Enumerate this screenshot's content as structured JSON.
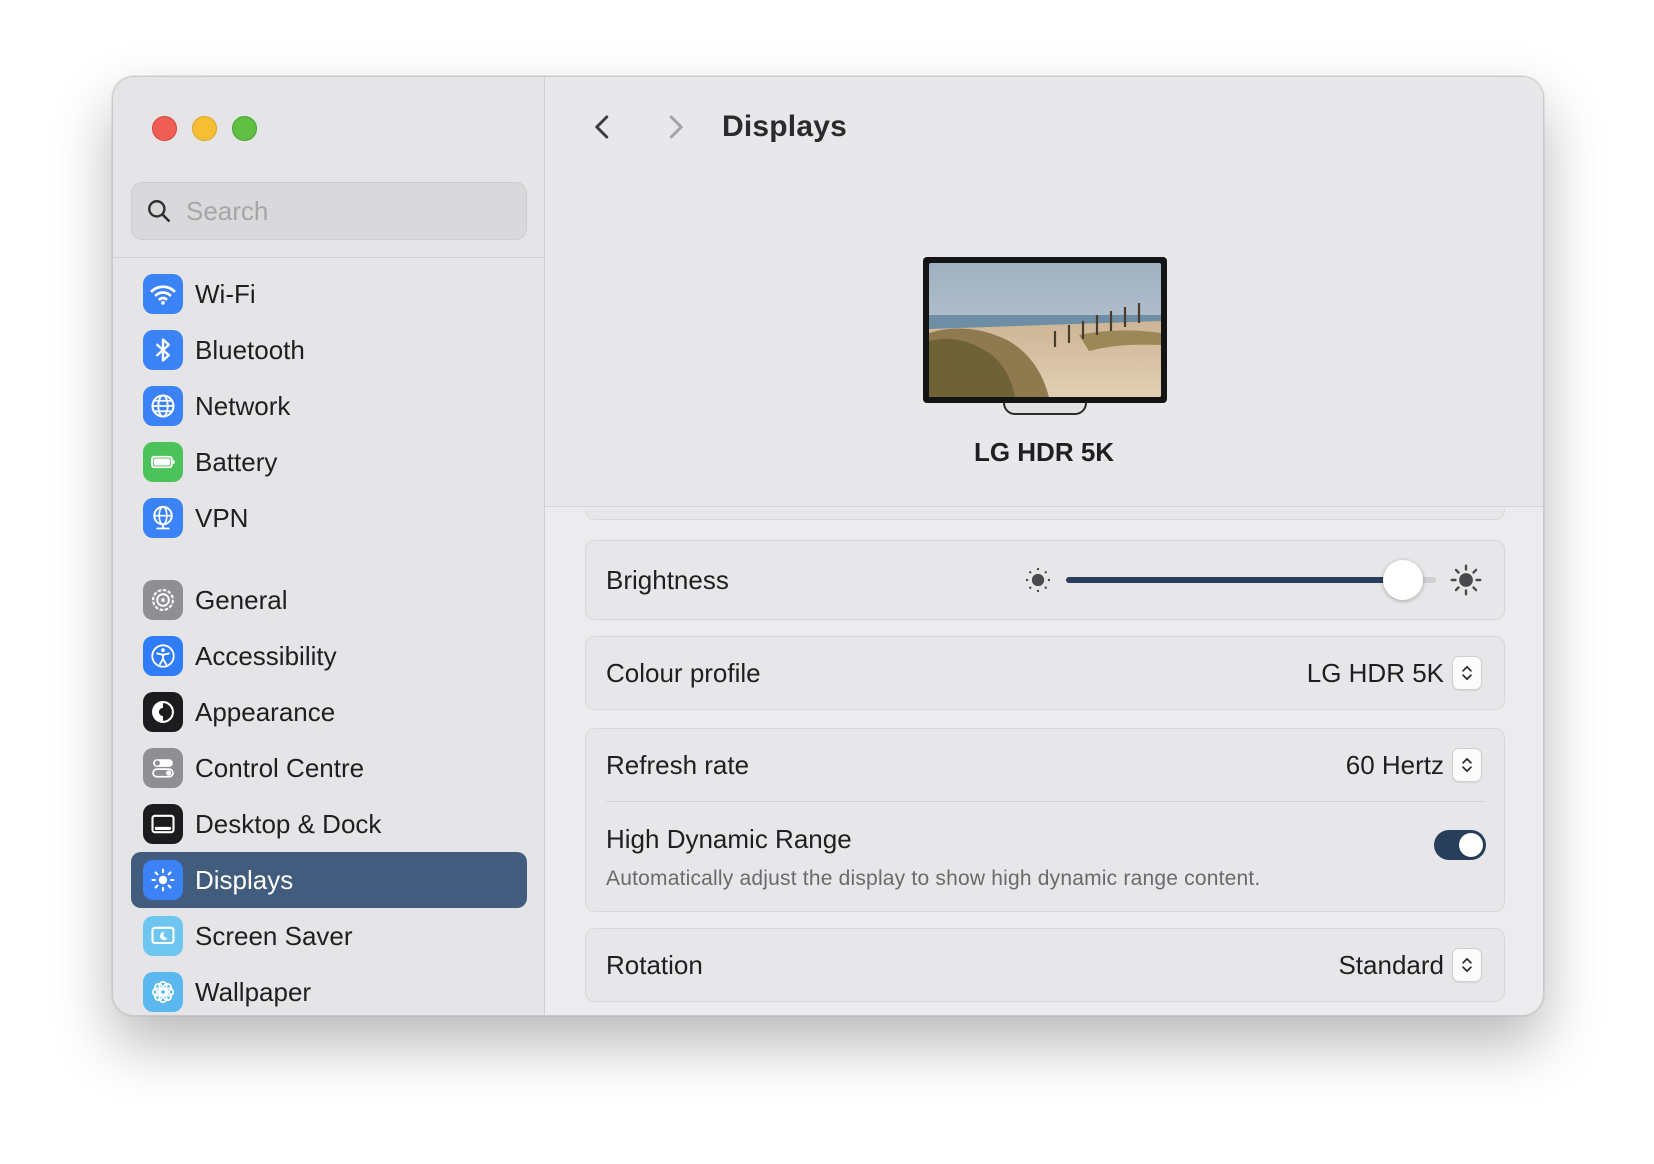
{
  "search": {
    "placeholder": "Search"
  },
  "sidebar": {
    "group1": [
      {
        "label": "Wi-Fi",
        "icon": "wifi-icon",
        "color": "#3b82f6"
      },
      {
        "label": "Bluetooth",
        "icon": "bluetooth-icon",
        "color": "#3b82f6"
      },
      {
        "label": "Network",
        "icon": "globe-icon",
        "color": "#3b82f6"
      },
      {
        "label": "Battery",
        "icon": "battery-icon",
        "color": "#4cc25a"
      },
      {
        "label": "VPN",
        "icon": "vpn-globe-icon",
        "color": "#3b82f6"
      }
    ],
    "group2": [
      {
        "label": "General",
        "icon": "gear-icon",
        "color": "#8e8e93"
      },
      {
        "label": "Accessibility",
        "icon": "accessibility-icon",
        "color": "#2f7cf6"
      },
      {
        "label": "Appearance",
        "icon": "appearance-icon",
        "color": "#1c1c1e"
      },
      {
        "label": "Control Centre",
        "icon": "toggles-icon",
        "color": "#8e8e93"
      },
      {
        "label": "Desktop & Dock",
        "icon": "dock-icon",
        "color": "#1c1c1e"
      },
      {
        "label": "Displays",
        "icon": "sun-icon",
        "color": "#3b82f6",
        "active": true
      },
      {
        "label": "Screen Saver",
        "icon": "screen-saver-icon",
        "color": "#6ec6f0"
      },
      {
        "label": "Wallpaper",
        "icon": "flower-icon",
        "color": "#5ab8ee"
      }
    ]
  },
  "header": {
    "title": "Displays",
    "display_name": "LG HDR 5K"
  },
  "settings": {
    "brightness": {
      "label": "Brightness",
      "value": 0.91
    },
    "colour_profile": {
      "label": "Colour profile",
      "value": "LG HDR 5K"
    },
    "refresh_rate": {
      "label": "Refresh rate",
      "value": "60 Hertz"
    },
    "hdr": {
      "label": "High Dynamic Range",
      "description": "Automatically adjust the display to show high dynamic range content.",
      "enabled": true
    },
    "rotation": {
      "label": "Rotation",
      "value": "Standard"
    }
  },
  "colors": {
    "accent": "#415c7c",
    "toggle_on": "#283f5b"
  }
}
